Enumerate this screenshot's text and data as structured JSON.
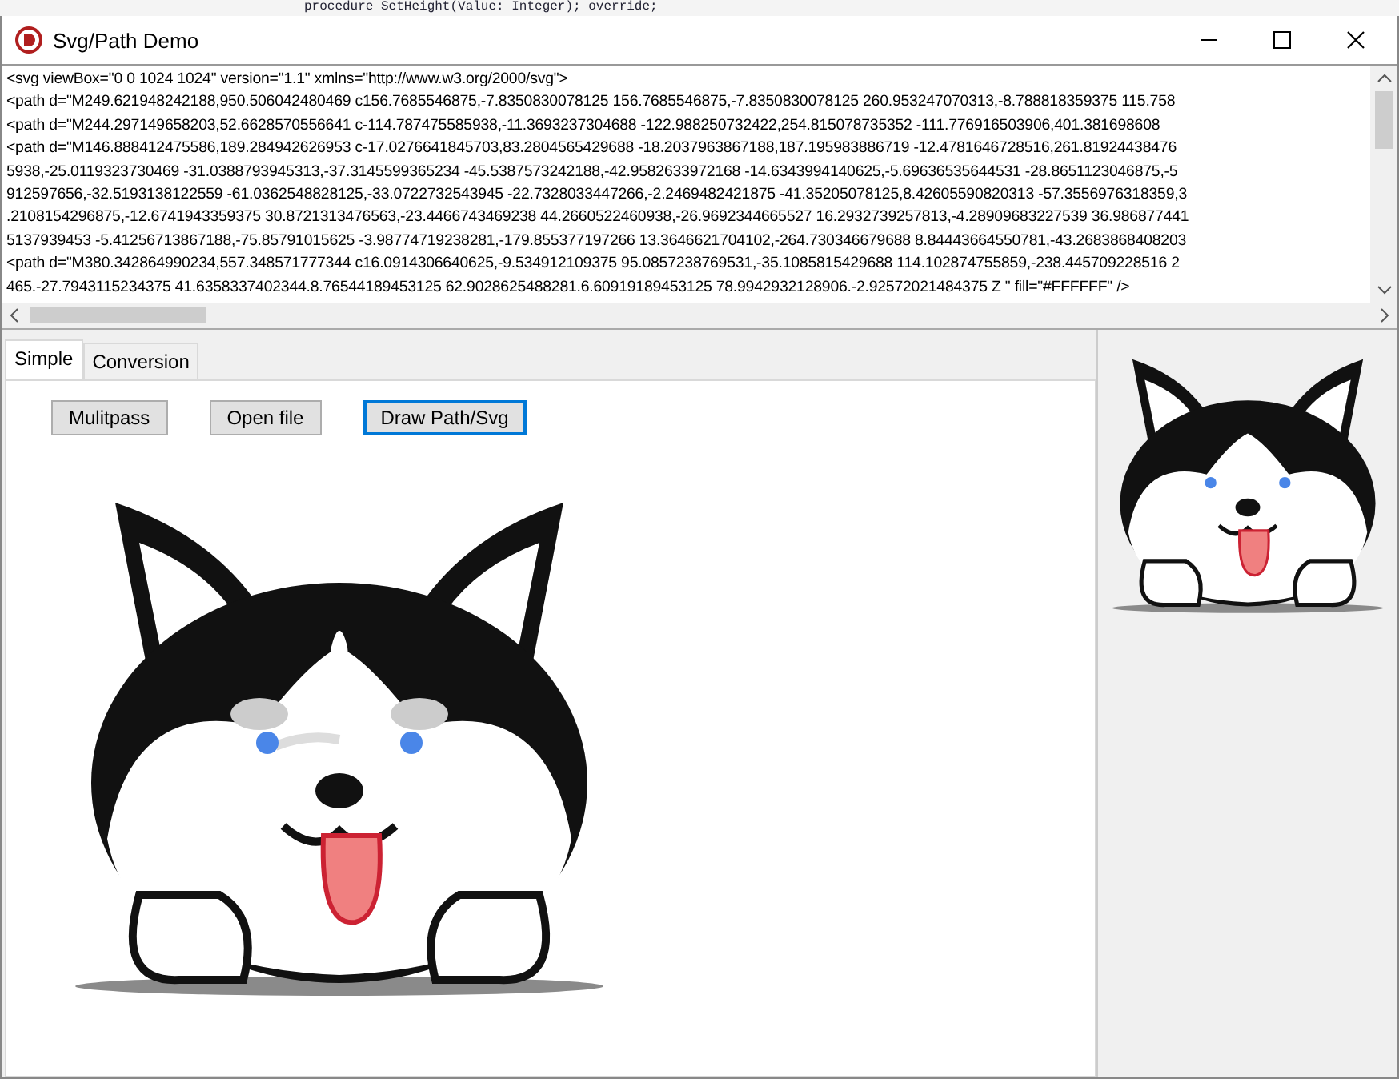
{
  "background_window": {
    "code_line": "procedure SetHeight(Value: Integer); override;"
  },
  "window": {
    "title": "Svg/Path Demo"
  },
  "memo": {
    "lines": [
      "<svg viewBox=\"0 0 1024 1024\" version=\"1.1\" xmlns=\"http://www.w3.org/2000/svg\">",
      "<path d=\"M249.621948242188,950.506042480469 c156.7685546875,-7.8350830078125 156.7685546875,-7.8350830078125 260.953247070313,-8.788818359375 115.758",
      "<path d=\"M244.297149658203,52.6628570556641 c-114.787475585938,-11.3693237304688 -122.988250732422,254.815078735352 -111.776916503906,401.381698608",
      "<path d=\"M146.888412475586,189.284942626953 c-17.0276641845703,83.2804565429688 -18.2037963867188,187.195983886719 -12.4781646728516,261.81924438476",
      "5938,-25.0119323730469 -31.0388793945313,-37.3145599365234 -45.5387573242188,-42.9582633972168 -14.6343994140625,-5.69636535644531 -28.8651123046875,-5",
      "912597656,-32.5193138122559 -61.0362548828125,-33.0722732543945 -22.7328033447266,-2.2469482421875 -41.35205078125,8.42605590820313 -57.3556976318359,3",
      ".2108154296875,-12.6741943359375 30.8721313476563,-23.4466743469238 44.2660522460938,-26.9692344665527 16.2932739257813,-4.28909683227539 36.986877441",
      "5137939453 -5.41256713867188,-75.85791015625 -3.98774719238281,-179.855377197266 13.3646621704102,-264.730346679688 8.84443664550781,-43.2683868408203",
      "<path d=\"M380.342864990234,557.348571777344 c16.0914306640625,-9.534912109375 95.0857238769531,-35.1085815429688 114.102874755859,-238.445709228516 2",
      "465.-27.7943115234375 41.6358337402344.8.76544189453125 62.9028625488281.6.60919189453125 78.9942932128906.-2.92572021484375 Z \" fill=\"#FFFFFF\" />"
    ]
  },
  "tabs": [
    {
      "label": "Simple",
      "selected": true
    },
    {
      "label": "Conversion",
      "selected": false
    }
  ],
  "buttons": [
    {
      "label": "Mulitpass",
      "focused": false
    },
    {
      "label": "Open file",
      "focused": false
    },
    {
      "label": "Draw Path/Svg",
      "focused": true
    }
  ]
}
